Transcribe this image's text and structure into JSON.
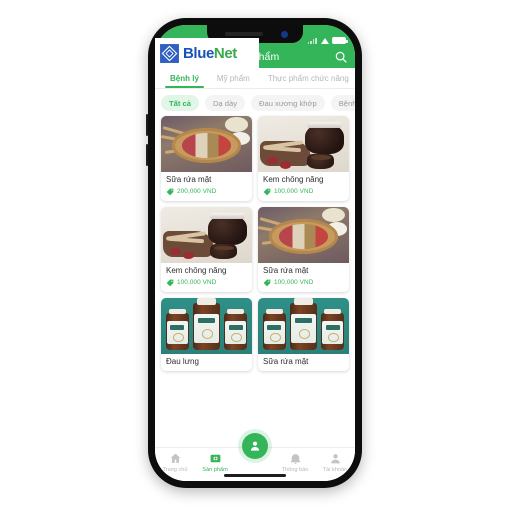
{
  "brand": {
    "name_part1": "Blue",
    "name_part2": "Net",
    "logo_icon": "blue-diamond-logo-icon",
    "blue_hex": "#1a52b8",
    "green_hex": "#3aa94b"
  },
  "status_bar": {
    "signal_icon": "cellular-signal-icon",
    "wifi_icon": "wifi-icon",
    "battery_icon": "battery-full-icon"
  },
  "header": {
    "title": "Sản phẩm",
    "search_icon": "search-icon",
    "background_hex": "#34b55a"
  },
  "tabs": [
    {
      "label": "Bệnh lý",
      "active": true
    },
    {
      "label": "Mỹ phẩm",
      "active": false
    },
    {
      "label": "Thực phẩm chức năng",
      "active": false
    }
  ],
  "chips": [
    {
      "label": "Tất cả",
      "active": true
    },
    {
      "label": "Dạ dày",
      "active": false
    },
    {
      "label": "Đau xương khớp",
      "active": false
    },
    {
      "label": "Bệnh về",
      "active": false
    }
  ],
  "products": [
    {
      "title": "Sữa rửa mặt",
      "price": "200,000 VND",
      "image": "herbal-bowl-photo",
      "tag_icon": "price-tag-icon"
    },
    {
      "title": "Kem chống nắng",
      "price": "100,000 VND",
      "image": "dark-herbal-jar-photo",
      "tag_icon": "price-tag-icon"
    },
    {
      "title": "Kem chống nắng",
      "price": "100,000 VND",
      "image": "dark-herbal-jar-photo",
      "tag_icon": "price-tag-icon"
    },
    {
      "title": "Sữa rửa mặt",
      "price": "100,000 VND",
      "image": "herbal-bowl-photo",
      "tag_icon": "price-tag-icon"
    },
    {
      "title": "Đau lưng",
      "price": "",
      "image": "supplement-bottles-photo",
      "tag_icon": "price-tag-icon"
    },
    {
      "title": "Sữa rửa mặt",
      "price": "",
      "image": "supplement-bottles-photo",
      "tag_icon": "price-tag-icon"
    }
  ],
  "bottom_nav": {
    "items": [
      {
        "label": "Trang chủ",
        "icon": "home-icon",
        "active": false
      },
      {
        "label": "Sản phẩm",
        "icon": "product-icon",
        "active": true
      },
      {
        "label": "Thông báo",
        "icon": "bell-icon",
        "active": false
      },
      {
        "label": "Tài khoản",
        "icon": "person-icon",
        "active": false
      }
    ],
    "fab_icon": "user-badge-icon",
    "home_indicator": "home-indicator-bar"
  }
}
